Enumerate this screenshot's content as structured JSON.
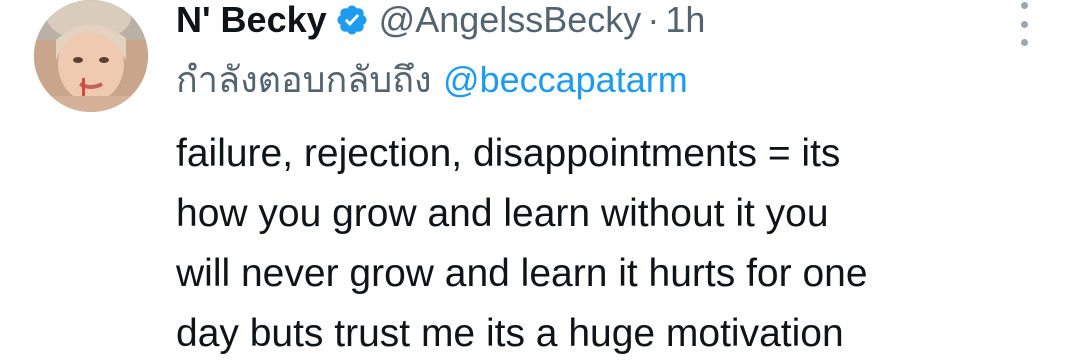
{
  "tweet": {
    "display_name": "N' Becky",
    "handle": "@AngelssBecky",
    "separator": "·",
    "time": "1h",
    "replying_prefix": "กำลังตอบกลับถึง",
    "replying_to": "@beccapatarm",
    "text_lines": [
      "failure, rejection, disappointments = its",
      "how you grow and learn without it you",
      "will never grow and learn it hurts for one",
      "day buts trust me its a huge motivation"
    ]
  },
  "icons": {
    "verified": "verified-badge-icon",
    "more": "more-options-icon"
  },
  "colors": {
    "text": "#0f1419",
    "secondary": "#536471",
    "accent": "#1d9bf0"
  }
}
